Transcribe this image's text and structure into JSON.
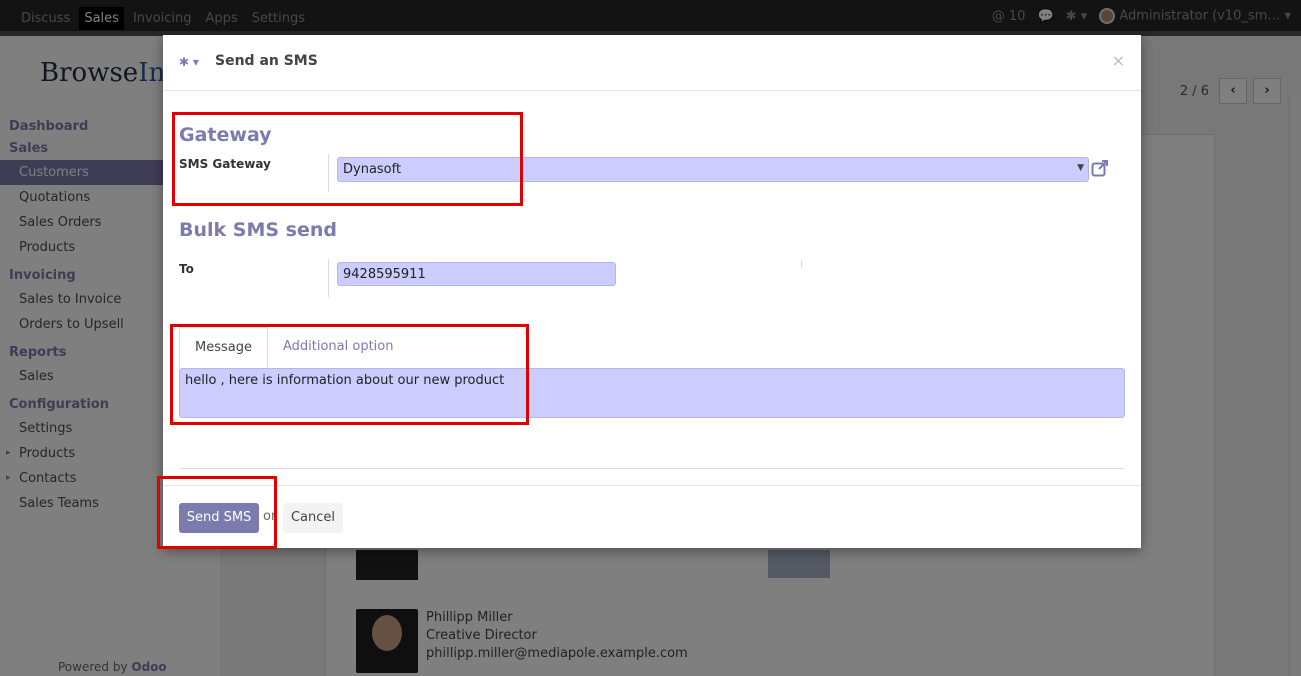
{
  "topbar": {
    "menus": [
      "Discuss",
      "Sales",
      "Invoicing",
      "Apps",
      "Settings"
    ],
    "active_menu_index": 1,
    "mentions": "10",
    "user": "Administrator (v10_sm…"
  },
  "app": {
    "logo_prefix": "Browse",
    "logo_suffix": "Inf",
    "pager": "2 / 6",
    "sidebar": [
      {
        "type": "section",
        "label": "Dashboard"
      },
      {
        "type": "section",
        "label": "Sales"
      },
      {
        "type": "item",
        "label": "Customers",
        "active": true
      },
      {
        "type": "item",
        "label": "Quotations"
      },
      {
        "type": "item",
        "label": "Sales Orders"
      },
      {
        "type": "item",
        "label": "Products"
      },
      {
        "type": "section",
        "label": "Invoicing"
      },
      {
        "type": "item",
        "label": "Sales to Invoice"
      },
      {
        "type": "item",
        "label": "Orders to Upsell"
      },
      {
        "type": "section",
        "label": "Reports"
      },
      {
        "type": "item",
        "label": "Sales"
      },
      {
        "type": "section",
        "label": "Configuration"
      },
      {
        "type": "item",
        "label": "Settings"
      },
      {
        "type": "item",
        "label": "Products",
        "sub": true
      },
      {
        "type": "item",
        "label": "Contacts",
        "sub": true
      },
      {
        "type": "item",
        "label": "Sales Teams"
      }
    ],
    "powered_prefix": "Powered by",
    "powered_brand": "Odoo",
    "contact": {
      "name": "Phillipp Miller",
      "title": "Creative Director",
      "email": "phillipp.miller@mediapole.example.com"
    }
  },
  "modal": {
    "title": "Send an SMS",
    "gateway_section": "Gateway",
    "gateway_label": "SMS Gateway",
    "gateway_value": "Dynasoft",
    "bulk_section": "Bulk SMS send",
    "to_label": "To",
    "to_value": "9428595911",
    "tabs": [
      "Message",
      "Additional option"
    ],
    "message": "hello , here is information about our new product",
    "send_label": "Send SMS",
    "or_text": "or",
    "cancel_label": "Cancel"
  },
  "colors": {
    "accent": "#7c7bad",
    "field_bg": "#ccccff",
    "highlight": "#e00000"
  }
}
